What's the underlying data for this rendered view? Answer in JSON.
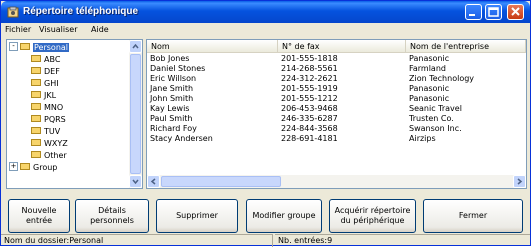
{
  "window": {
    "title": "Répertoire téléphonique"
  },
  "menu": [
    "Fichier",
    "Visualiser",
    "Aide"
  ],
  "tree": {
    "items": [
      {
        "label": "Personal",
        "selected": true,
        "expander": "-"
      },
      {
        "label": "ABC"
      },
      {
        "label": "DEF"
      },
      {
        "label": "GHI"
      },
      {
        "label": "JKL"
      },
      {
        "label": "MNO"
      },
      {
        "label": "PQRS"
      },
      {
        "label": "TUV"
      },
      {
        "label": "WXYZ"
      },
      {
        "label": "Other"
      },
      {
        "label": "Group",
        "expander": "+"
      }
    ]
  },
  "list": {
    "columns": [
      "Nom",
      "N° de fax",
      "Nom de l'entreprise"
    ],
    "rows": [
      [
        "Bob Jones",
        "201-555-1818",
        "Panasonic"
      ],
      [
        "Daniel Stones",
        "214-268-5561",
        "Farmland"
      ],
      [
        "Eric Willson",
        "224-312-2621",
        "Zion Technology"
      ],
      [
        "Jane Smith",
        "201-555-1919",
        "Panasonic"
      ],
      [
        "John Smith",
        "201-555-1212",
        "Panasonic"
      ],
      [
        "Kay Lewis",
        "206-453-9468",
        "Seanic Travel"
      ],
      [
        "Paul Smith",
        "246-335-6287",
        "Trusten Co."
      ],
      [
        "Richard Foy",
        "224-844-3568",
        "Swanson Inc."
      ],
      [
        "Stacy Andersen",
        "228-691-4181",
        "Airzips"
      ]
    ]
  },
  "buttons": {
    "new_entry": "Nouvelle entrée",
    "personal_details": "Détails personnels",
    "delete": "Supprimer",
    "edit_group": "Modifier groupe",
    "acquire_line1": "Acquérir répertoire",
    "acquire_line2": "du périphérique",
    "close": "Fermer"
  },
  "status": {
    "folder": "Nom du dossier:Personal",
    "entries": "Nb. entrées:9"
  },
  "colors": {
    "titlebar": "#0553df",
    "selection": "#316ac5",
    "face": "#ece9d8"
  }
}
